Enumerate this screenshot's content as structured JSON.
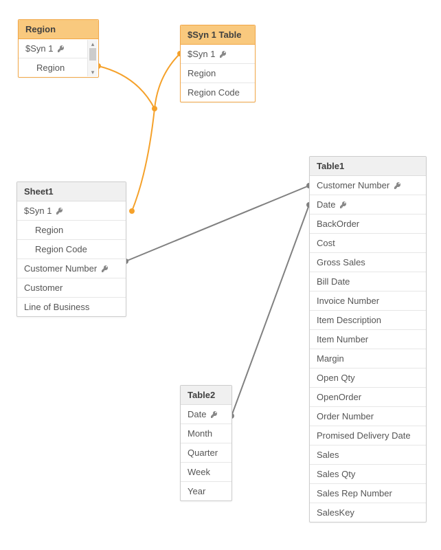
{
  "colors": {
    "linkOrange": "#f5a12a",
    "linkGray": "#808080",
    "nodeDot": "#999999"
  },
  "tables": {
    "region": {
      "title": "Region",
      "fields": [
        {
          "name": "$Syn 1",
          "key": true,
          "indent": false
        },
        {
          "name": "Region",
          "key": false,
          "indent": true
        }
      ]
    },
    "syn1": {
      "title": "$Syn 1 Table",
      "fields": [
        {
          "name": "$Syn 1",
          "key": true,
          "indent": false
        },
        {
          "name": "Region",
          "key": false,
          "indent": false
        },
        {
          "name": "Region Code",
          "key": false,
          "indent": false
        }
      ]
    },
    "sheet1": {
      "title": "Sheet1",
      "fields": [
        {
          "name": "$Syn 1",
          "key": true,
          "indent": false
        },
        {
          "name": "Region",
          "key": false,
          "indent": true
        },
        {
          "name": "Region Code",
          "key": false,
          "indent": true
        },
        {
          "name": "Customer Number",
          "key": true,
          "indent": false
        },
        {
          "name": "Customer",
          "key": false,
          "indent": false
        },
        {
          "name": "Line of Business",
          "key": false,
          "indent": false
        }
      ]
    },
    "table2": {
      "title": "Table2",
      "fields": [
        {
          "name": "Date",
          "key": true,
          "indent": false
        },
        {
          "name": "Month",
          "key": false,
          "indent": false
        },
        {
          "name": "Quarter",
          "key": false,
          "indent": false
        },
        {
          "name": "Week",
          "key": false,
          "indent": false
        },
        {
          "name": "Year",
          "key": false,
          "indent": false
        }
      ]
    },
    "table1": {
      "title": "Table1",
      "fields": [
        {
          "name": "Customer Number",
          "key": true,
          "indent": false
        },
        {
          "name": "Date",
          "key": true,
          "indent": false
        },
        {
          "name": "BackOrder",
          "key": false,
          "indent": false
        },
        {
          "name": "Cost",
          "key": false,
          "indent": false
        },
        {
          "name": "Gross Sales",
          "key": false,
          "indent": false
        },
        {
          "name": "Bill Date",
          "key": false,
          "indent": false
        },
        {
          "name": "Invoice Number",
          "key": false,
          "indent": false
        },
        {
          "name": "Item Description",
          "key": false,
          "indent": false
        },
        {
          "name": "Item Number",
          "key": false,
          "indent": false
        },
        {
          "name": "Margin",
          "key": false,
          "indent": false
        },
        {
          "name": "Open Qty",
          "key": false,
          "indent": false
        },
        {
          "name": "OpenOrder",
          "key": false,
          "indent": false
        },
        {
          "name": "Order Number",
          "key": false,
          "indent": false
        },
        {
          "name": "Promised Delivery Date",
          "key": false,
          "indent": false
        },
        {
          "name": "Sales",
          "key": false,
          "indent": false
        },
        {
          "name": "Sales Qty",
          "key": false,
          "indent": false
        },
        {
          "name": "Sales Rep Number",
          "key": false,
          "indent": false
        },
        {
          "name": "SalesKey",
          "key": false,
          "indent": false
        }
      ]
    }
  }
}
